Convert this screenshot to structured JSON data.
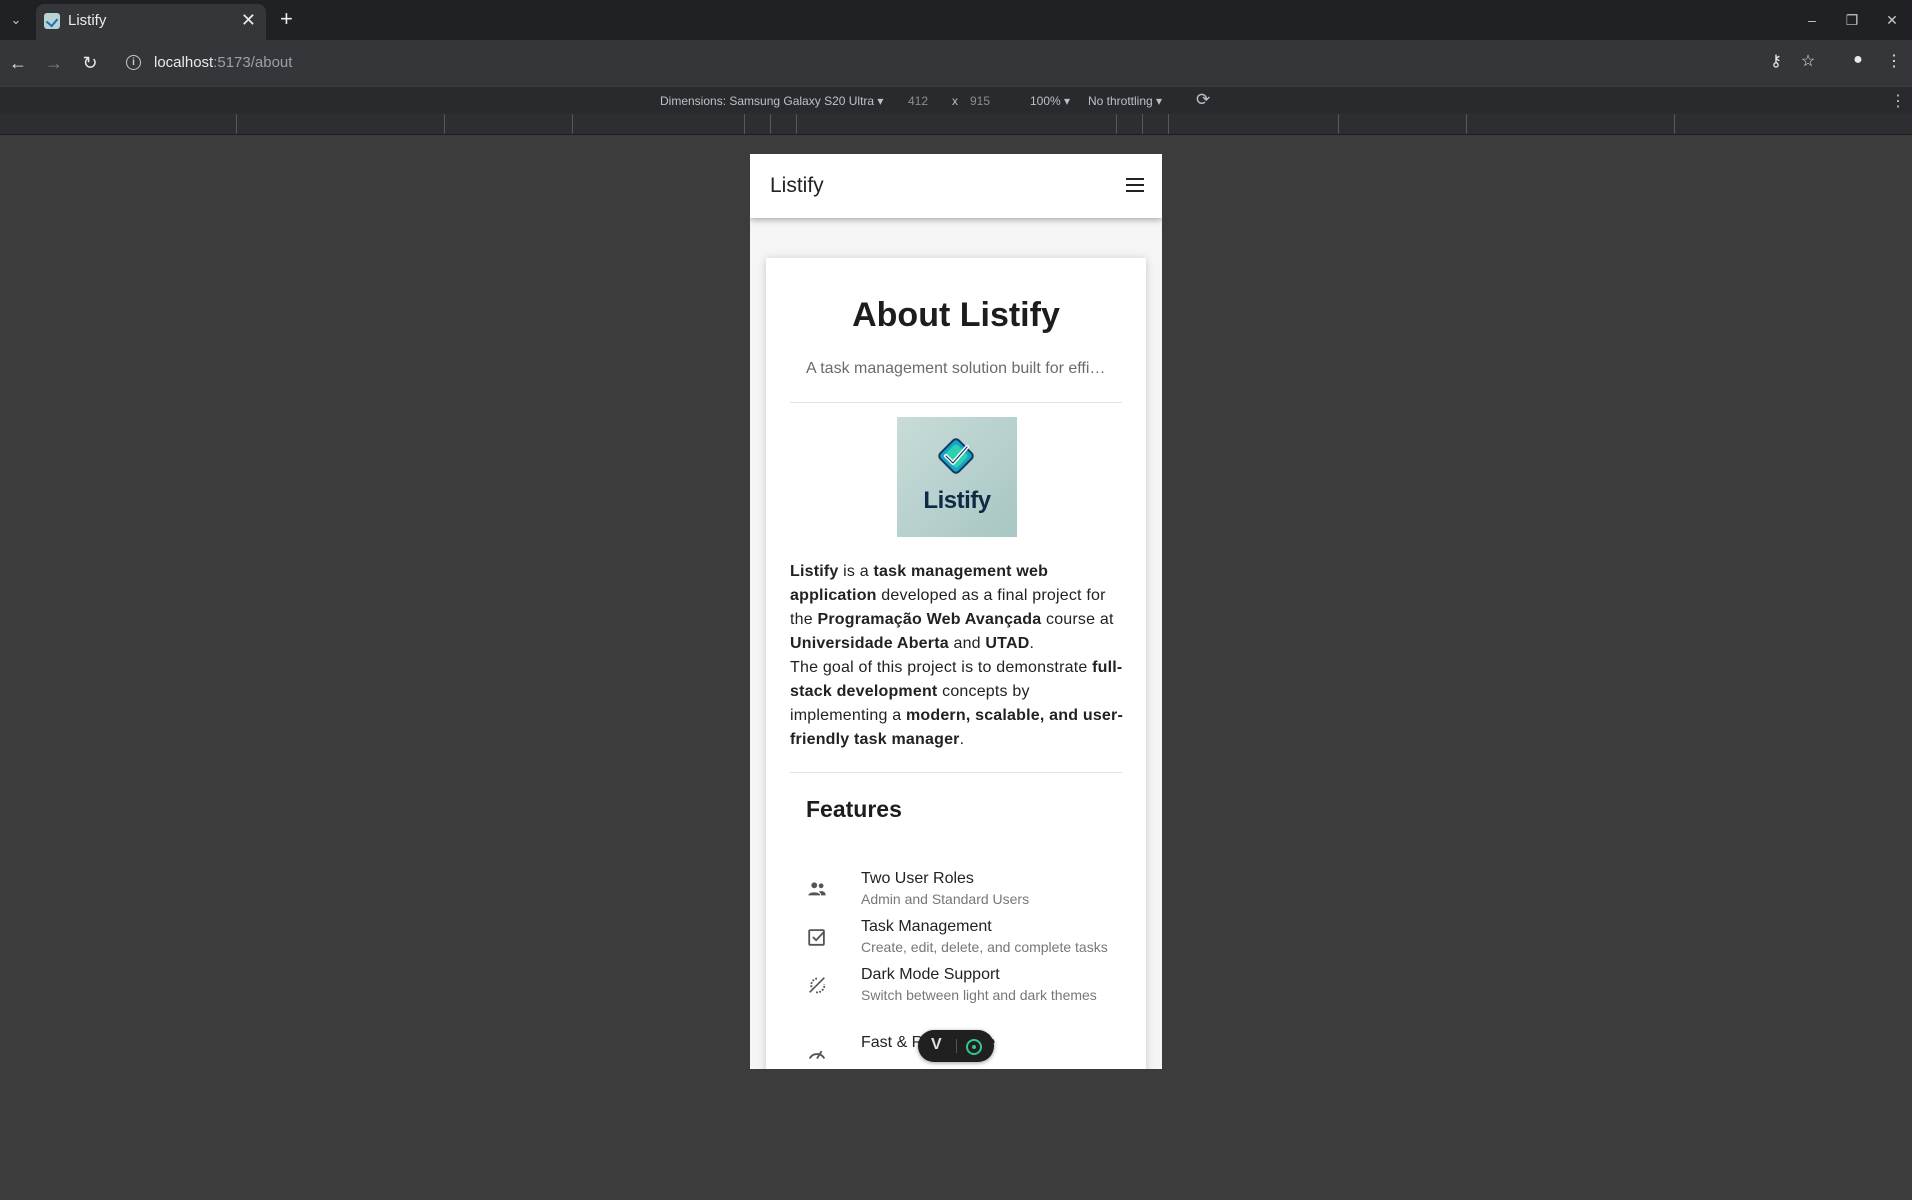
{
  "browser": {
    "tab_title": "Listify",
    "tab_close": "✕",
    "new_tab": "+",
    "url_host": "localhost",
    "url_path": ":5173/about"
  },
  "devtools": {
    "dimensions_label": "Dimensions: Samsung Galaxy S20 Ultra",
    "width": "412",
    "times": "x",
    "height": "915",
    "zoom": "100%",
    "throttling": "No throttling"
  },
  "app": {
    "brand": "Listify",
    "about": {
      "title": "About Listify",
      "subtitle": "A task management solution built for efficiency",
      "logo_text": "Listify",
      "desc": {
        "s1": "Listify",
        "s2": " is a ",
        "s3": "task management web application",
        "s4": " developed as a final project for the ",
        "s5": "Programação Web Avançada",
        "s6": " course at ",
        "s7": "Universidade Aberta",
        "s8": " and ",
        "s9": "UTAD",
        "s10": ".",
        "s11": "The goal of this project is to demonstrate ",
        "s12": "full-stack development",
        "s13": " concepts by implementing a ",
        "s14": "modern, scalable, and user-friendly task manager",
        "s15": "."
      }
    },
    "features": {
      "title": "Features",
      "items": [
        {
          "name": "Two User Roles",
          "desc": "Admin and Standard Users",
          "icon": "people-icon"
        },
        {
          "name": "Task Management",
          "desc": "Create, edit, delete, and complete tasks",
          "icon": "checkbox-icon"
        },
        {
          "name": "Dark Mode Support",
          "desc": "Switch between light and dark themes",
          "icon": "dark-mode-icon"
        },
        {
          "name": "Fast & Responsive",
          "desc": "",
          "icon": "speed-icon"
        }
      ]
    }
  }
}
